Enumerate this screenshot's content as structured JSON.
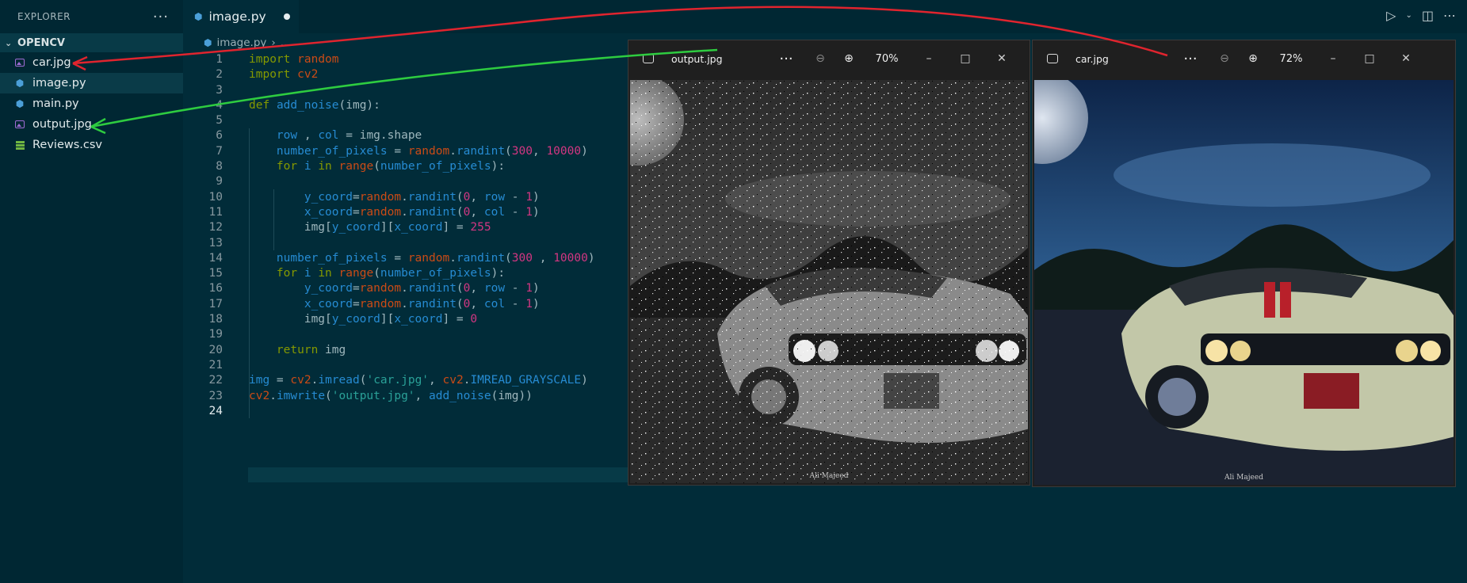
{
  "sidebar": {
    "title": "EXPLORER",
    "more": "···",
    "folder": "OPENCV",
    "files": [
      {
        "name": "car.jpg",
        "type": "image"
      },
      {
        "name": "image.py",
        "type": "python"
      },
      {
        "name": "main.py",
        "type": "python"
      },
      {
        "name": "output.jpg",
        "type": "image"
      },
      {
        "name": "Reviews.csv",
        "type": "csv"
      }
    ]
  },
  "editor": {
    "tab_label": "image.py",
    "breadcrumb_file": "image.py",
    "breadcrumb_rest": "...",
    "line_numbers": [
      "1",
      "2",
      "3",
      "4",
      "5",
      "6",
      "7",
      "8",
      "9",
      "10",
      "11",
      "12",
      "13",
      "14",
      "15",
      "16",
      "17",
      "18",
      "19",
      "20",
      "21",
      "22",
      "23",
      "24"
    ]
  },
  "windows": {
    "output": {
      "title": "output.jpg",
      "zoom": "70%",
      "more": "···",
      "caption": "Ali Majeed"
    },
    "car": {
      "title": "car.jpg",
      "zoom": "72%",
      "more": "···",
      "caption": "Ali Majeed"
    }
  },
  "colors": {
    "editor_bg": "#012c39",
    "sidebar_bg": "#002733",
    "arrow_red": "#e0242e",
    "arrow_green": "#2ecc40"
  }
}
